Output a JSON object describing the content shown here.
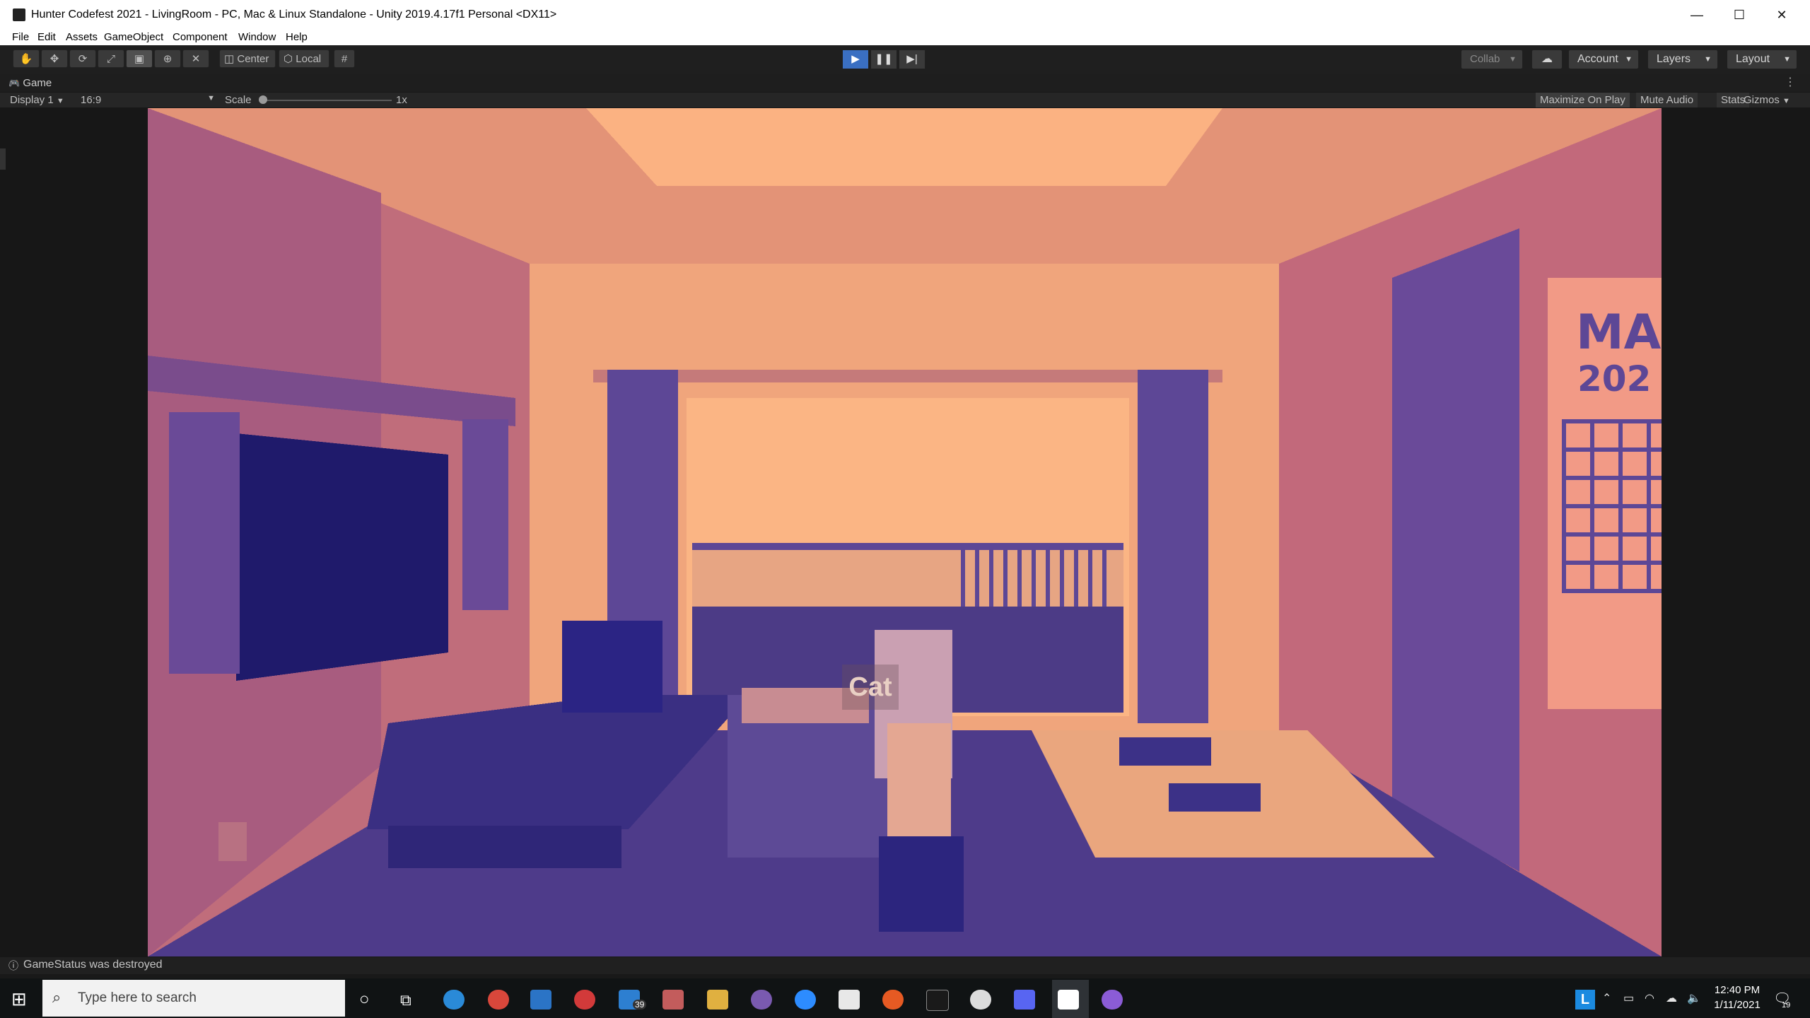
{
  "window": {
    "title": "Hunter Codefest 2021 - LivingRoom - PC, Mac & Linux Standalone - Unity 2019.4.17f1 Personal <DX11>",
    "minimize": "—",
    "maximize": "☐",
    "close": "✕"
  },
  "menu": [
    "File",
    "Edit",
    "Assets",
    "GameObject",
    "Component",
    "Window",
    "Help"
  ],
  "toolbar": {
    "pivot_center": "Center",
    "pivot_local": "Local",
    "collab": "Collab",
    "account": "Account",
    "layers": "Layers",
    "layout": "Layout"
  },
  "game": {
    "tab_label": "Game",
    "display": "Display 1",
    "aspect": "16:9",
    "scale_label": "Scale",
    "scale_value": "1x",
    "scale_fraction": 0,
    "maximize_on_play": "Maximize On Play",
    "mute_audio": "Mute Audio",
    "stats": "Stats",
    "gizmos": "Gizmos",
    "cat_label": "Cat",
    "calendar_text_1": "MA",
    "calendar_text_2": "202"
  },
  "status": {
    "message": "GameStatus was destroyed"
  },
  "taskbar": {
    "search_placeholder": "Type here to search",
    "mail_badge": "39",
    "time": "12:40 PM",
    "date": "1/11/2021",
    "notification_count": "19"
  },
  "colors": {
    "play_active": "#3a6fc2",
    "room_light": "#f0a57c",
    "room_dark": "#3e3387"
  }
}
